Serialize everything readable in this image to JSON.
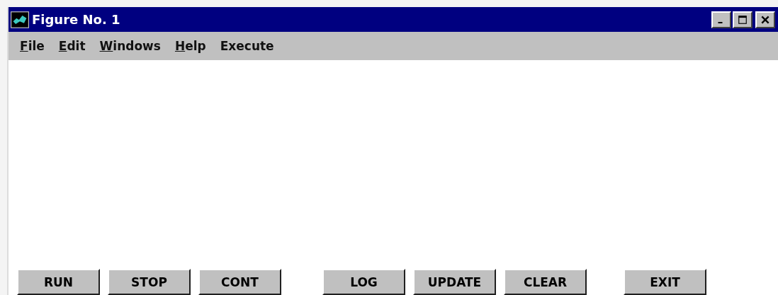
{
  "window": {
    "title": "Figure No. 1"
  },
  "menu": [
    {
      "label": "File",
      "underlined": true
    },
    {
      "label": "Edit",
      "underlined": true
    },
    {
      "label": "Windows",
      "underlined": true
    },
    {
      "label": "Help",
      "underlined": true
    },
    {
      "label": "Execute",
      "underlined": false
    }
  ],
  "button_groups": [
    [
      "RUN",
      "STOP",
      "CONT"
    ],
    [
      "LOG",
      "UPDATE",
      "CLEAR"
    ],
    [
      "EXIT"
    ]
  ]
}
